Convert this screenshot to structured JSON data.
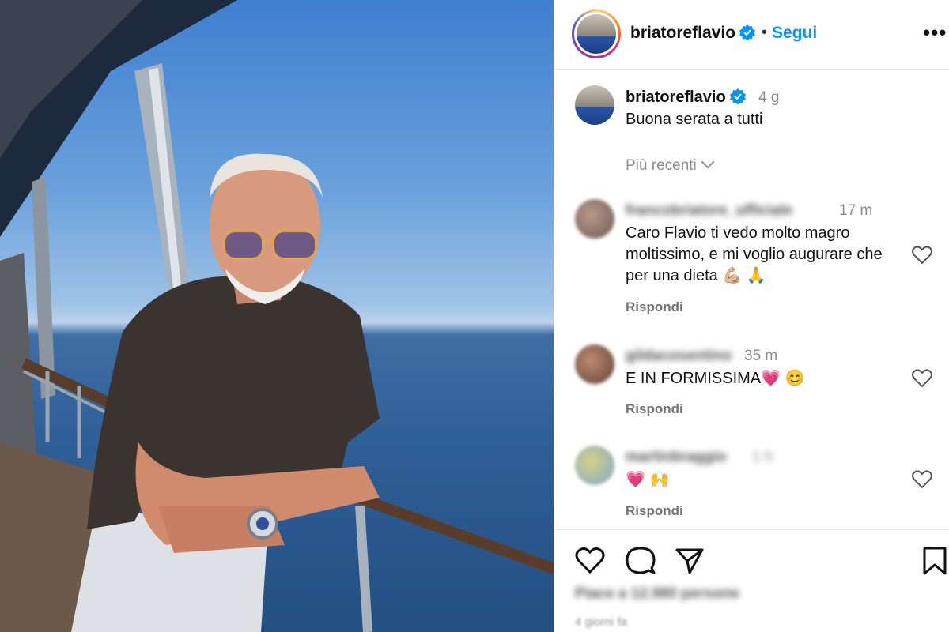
{
  "header": {
    "username": "briatoreflavio",
    "separator": "•",
    "follow_label": "Segui",
    "more_label": "•••"
  },
  "caption": {
    "username": "briatoreflavio",
    "time": "4 g",
    "text": "Buona serata a tutti"
  },
  "sort": {
    "label": "Più recenti"
  },
  "comments": [
    {
      "username": "francobriatore_ufficiale",
      "time": "17 m",
      "text": "Caro Flavio ti vedo molto magro moltissimo, e mi voglio augurare che per una dieta 💪🏼 🙏",
      "reply": "Rispondi"
    },
    {
      "username": "gildacosentino",
      "time": "35 m",
      "text": "E IN FORMISSIMA💗 😊",
      "reply": "Rispondi"
    },
    {
      "username": "martinbraggio",
      "time": "1 h",
      "text": "💗 🙌",
      "reply": "Rispondi"
    }
  ],
  "footer": {
    "likes": "Piace a 12.980 persone",
    "date": "4 giorni fa"
  },
  "icons": [
    "verified-icon",
    "more-icon",
    "chevron-down-icon",
    "heart-icon",
    "comment-icon",
    "share-icon",
    "bookmark-icon"
  ],
  "colors": {
    "accent": "#0095f6",
    "verified": "#0095f6",
    "muted": "#8e8e8e"
  }
}
